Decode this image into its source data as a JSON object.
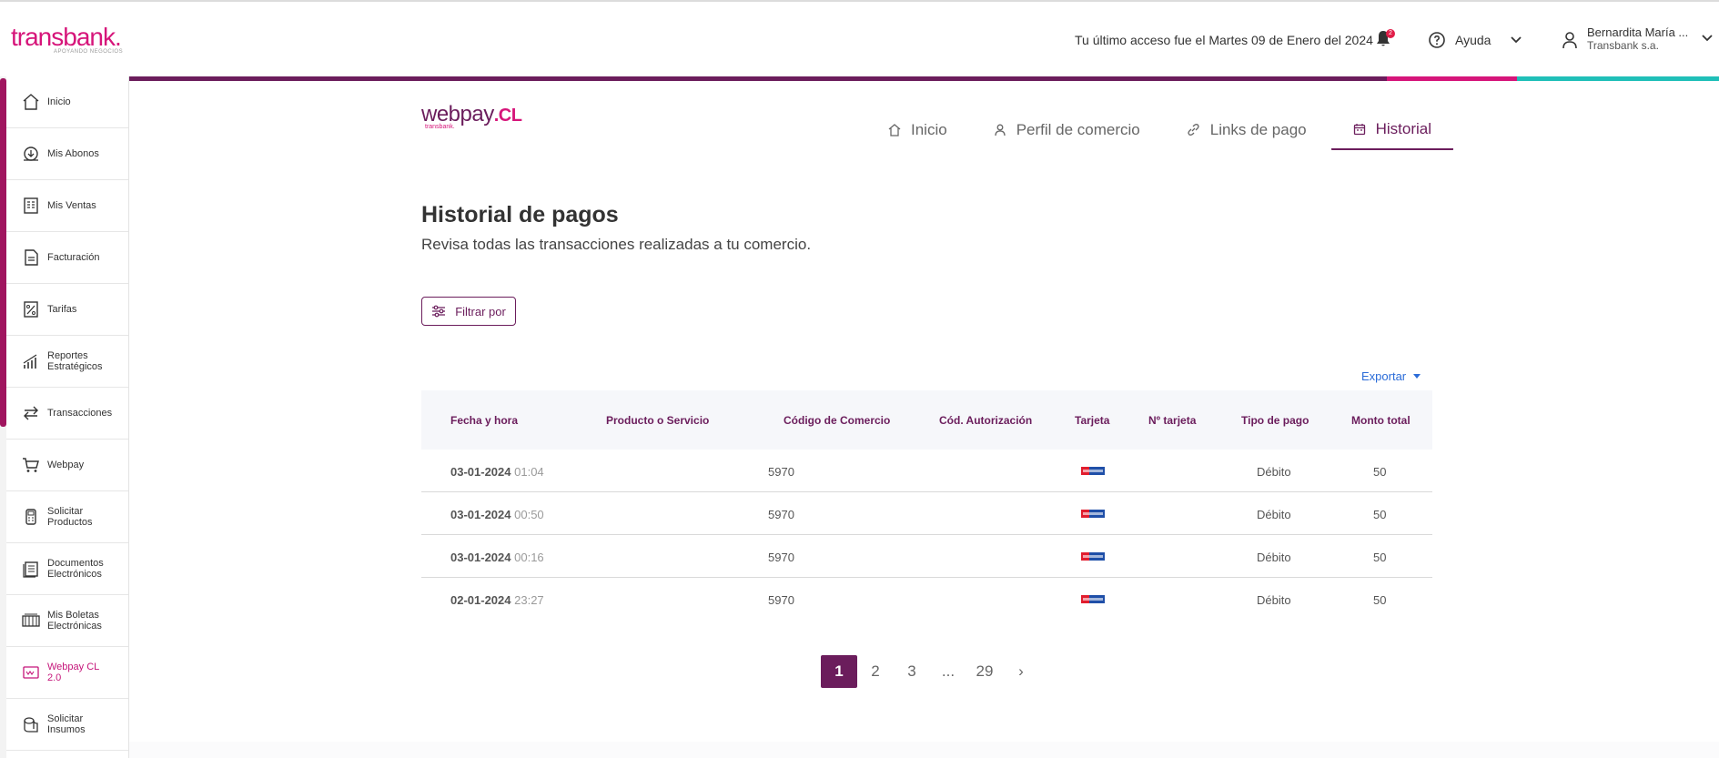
{
  "header": {
    "logo_text": "transbank.",
    "logo_tagline": "APOYANDO NEGOCIOS",
    "last_access": "Tu último acceso fue el Martes 09 de Enero del 2024",
    "notifications_count": "2",
    "help_label": "Ayuda",
    "user_name": "Bernardita María ...",
    "user_company": "Transbank s.a."
  },
  "sidebar": {
    "items": [
      {
        "label": "Inicio",
        "icon": "home-icon"
      },
      {
        "label": "Mis Abonos",
        "icon": "deposit-icon"
      },
      {
        "label": "Mis Ventas",
        "icon": "sales-receipt-icon"
      },
      {
        "label": "Facturación",
        "icon": "invoice-icon"
      },
      {
        "label": "Tarifas",
        "icon": "percent-doc-icon"
      },
      {
        "label": "Reportes Estratégicos",
        "icon": "chart-icon"
      },
      {
        "label": "Transacciones",
        "icon": "transfer-icon"
      },
      {
        "label": "Webpay",
        "icon": "cart-icon"
      },
      {
        "label": "Solicitar Productos",
        "icon": "pos-terminal-icon"
      },
      {
        "label": "Documentos Electrónicos",
        "icon": "documents-icon"
      },
      {
        "label": "Mis Boletas Electrónicas",
        "icon": "receipts-icon"
      },
      {
        "label": "Webpay CL 2.0",
        "icon": "webpay-icon"
      },
      {
        "label": "Solicitar Insumos",
        "icon": "paper-roll-icon"
      }
    ],
    "active_index": 11
  },
  "webpay_logo": {
    "text": "webpay",
    "suffix": ".CL",
    "sub": "transbank."
  },
  "tabs": [
    {
      "label": "Inicio",
      "icon": "home-icon"
    },
    {
      "label": "Perfil de comercio",
      "icon": "person-icon"
    },
    {
      "label": "Links de pago",
      "icon": "link-icon"
    },
    {
      "label": "Historial",
      "icon": "calendar-icon"
    }
  ],
  "page": {
    "title": "Historial de pagos",
    "subtitle": "Revisa todas las transacciones realizadas a tu comercio.",
    "filter_label": "Filtrar por",
    "export_label": "Exportar"
  },
  "table": {
    "columns": [
      "Fecha y hora",
      "Producto o Servicio",
      "Código de Comercio",
      "Cód. Autorización",
      "Tarjeta",
      "Nº tarjeta",
      "Tipo de pago",
      "Monto total"
    ],
    "rows": [
      {
        "date": "03-01-2024",
        "time": "01:04",
        "code": "5970",
        "card": "redcompra",
        "tipo": "Débito",
        "monto": "50"
      },
      {
        "date": "03-01-2024",
        "time": "00:50",
        "code": "5970",
        "card": "redcompra",
        "tipo": "Débito",
        "monto": "50"
      },
      {
        "date": "03-01-2024",
        "time": "00:16",
        "code": "5970",
        "card": "redcompra",
        "tipo": "Débito",
        "monto": "50"
      },
      {
        "date": "02-01-2024",
        "time": "23:27",
        "code": "5970",
        "card": "redcompra",
        "tipo": "Débito",
        "monto": "50"
      }
    ]
  },
  "pagination": {
    "pages": [
      "1",
      "2",
      "3",
      "...",
      "29"
    ],
    "current": "1",
    "next": "›"
  },
  "colors": {
    "primary": "#6b1d5c",
    "brand_pink": "#d6157a",
    "teal": "#1fbfb8",
    "link_blue": "#2b6cd8"
  }
}
